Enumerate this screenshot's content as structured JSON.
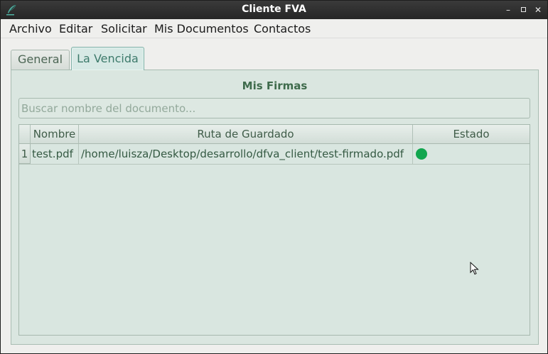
{
  "window": {
    "title": "Cliente FVA"
  },
  "menubar": {
    "items": [
      "Archivo",
      "Editar",
      "Solicitar",
      "Mis Documentos",
      "Contactos"
    ]
  },
  "tabs": [
    {
      "label": "General",
      "active": false
    },
    {
      "label": "La Vencida",
      "active": true
    }
  ],
  "panel": {
    "title": "Mis Firmas",
    "search": {
      "value": "",
      "placeholder": "Buscar nombre del documento..."
    },
    "table": {
      "columns": [
        "Nombre",
        "Ruta de Guardado",
        "Estado"
      ],
      "rows": [
        {
          "index": "1",
          "name": "test.pdf",
          "path": "/home/luisza/Desktop/desarrollo/dfva_client/test-firmado.pdf",
          "status_color": "#12a64f"
        }
      ]
    }
  },
  "colors": {
    "accent": "#3d7a6b",
    "panel_bg": "#dae6e0",
    "status_ok": "#12a64f"
  }
}
